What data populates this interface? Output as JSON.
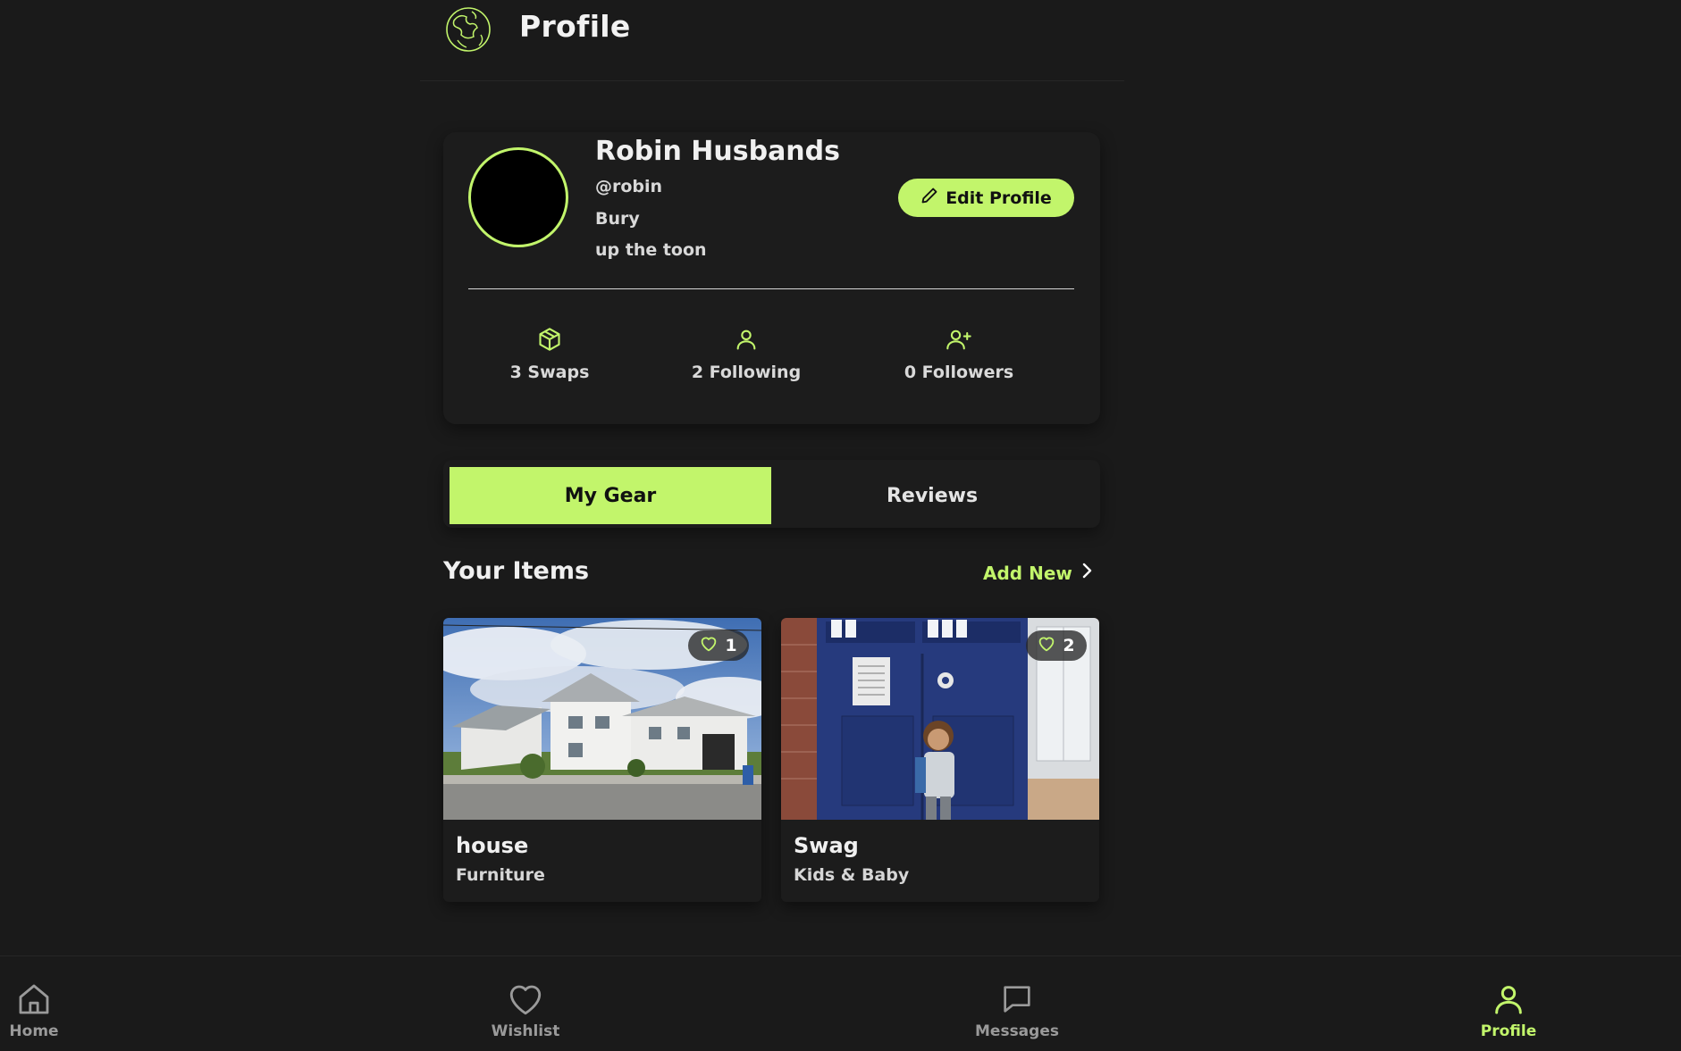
{
  "header": {
    "title": "Profile",
    "logo_icon": "globe-logo-icon"
  },
  "profile": {
    "name": "Robin Husbands",
    "handle": "@robin",
    "location": "Bury",
    "bio": "up the toon",
    "edit_label": "Edit Profile"
  },
  "stats": [
    {
      "label": "3 Swaps",
      "icon": "box-icon"
    },
    {
      "label": "2 Following",
      "icon": "user-icon"
    },
    {
      "label": "0 Followers",
      "icon": "user-plus-icon"
    }
  ],
  "tabs": [
    {
      "label": "My Gear",
      "active": true
    },
    {
      "label": "Reviews",
      "active": false
    }
  ],
  "section": {
    "title": "Your Items",
    "add_new": "Add New"
  },
  "items": [
    {
      "title": "house",
      "category": "Furniture",
      "likes": "1",
      "image": "white house photo"
    },
    {
      "title": "Swag",
      "category": "Kids & Baby",
      "likes": "2",
      "image": "child beside blue police box"
    }
  ],
  "nav": [
    {
      "label": "Home",
      "icon": "home-icon"
    },
    {
      "label": "Wishlist",
      "icon": "heart-icon"
    },
    {
      "label": "Messages",
      "icon": "message-icon"
    },
    {
      "label": "Profile",
      "icon": "user-icon",
      "active": true
    }
  ],
  "colors": {
    "accent": "#c2f56b",
    "background": "#1a1a1a",
    "card": "#1c1c1c"
  }
}
